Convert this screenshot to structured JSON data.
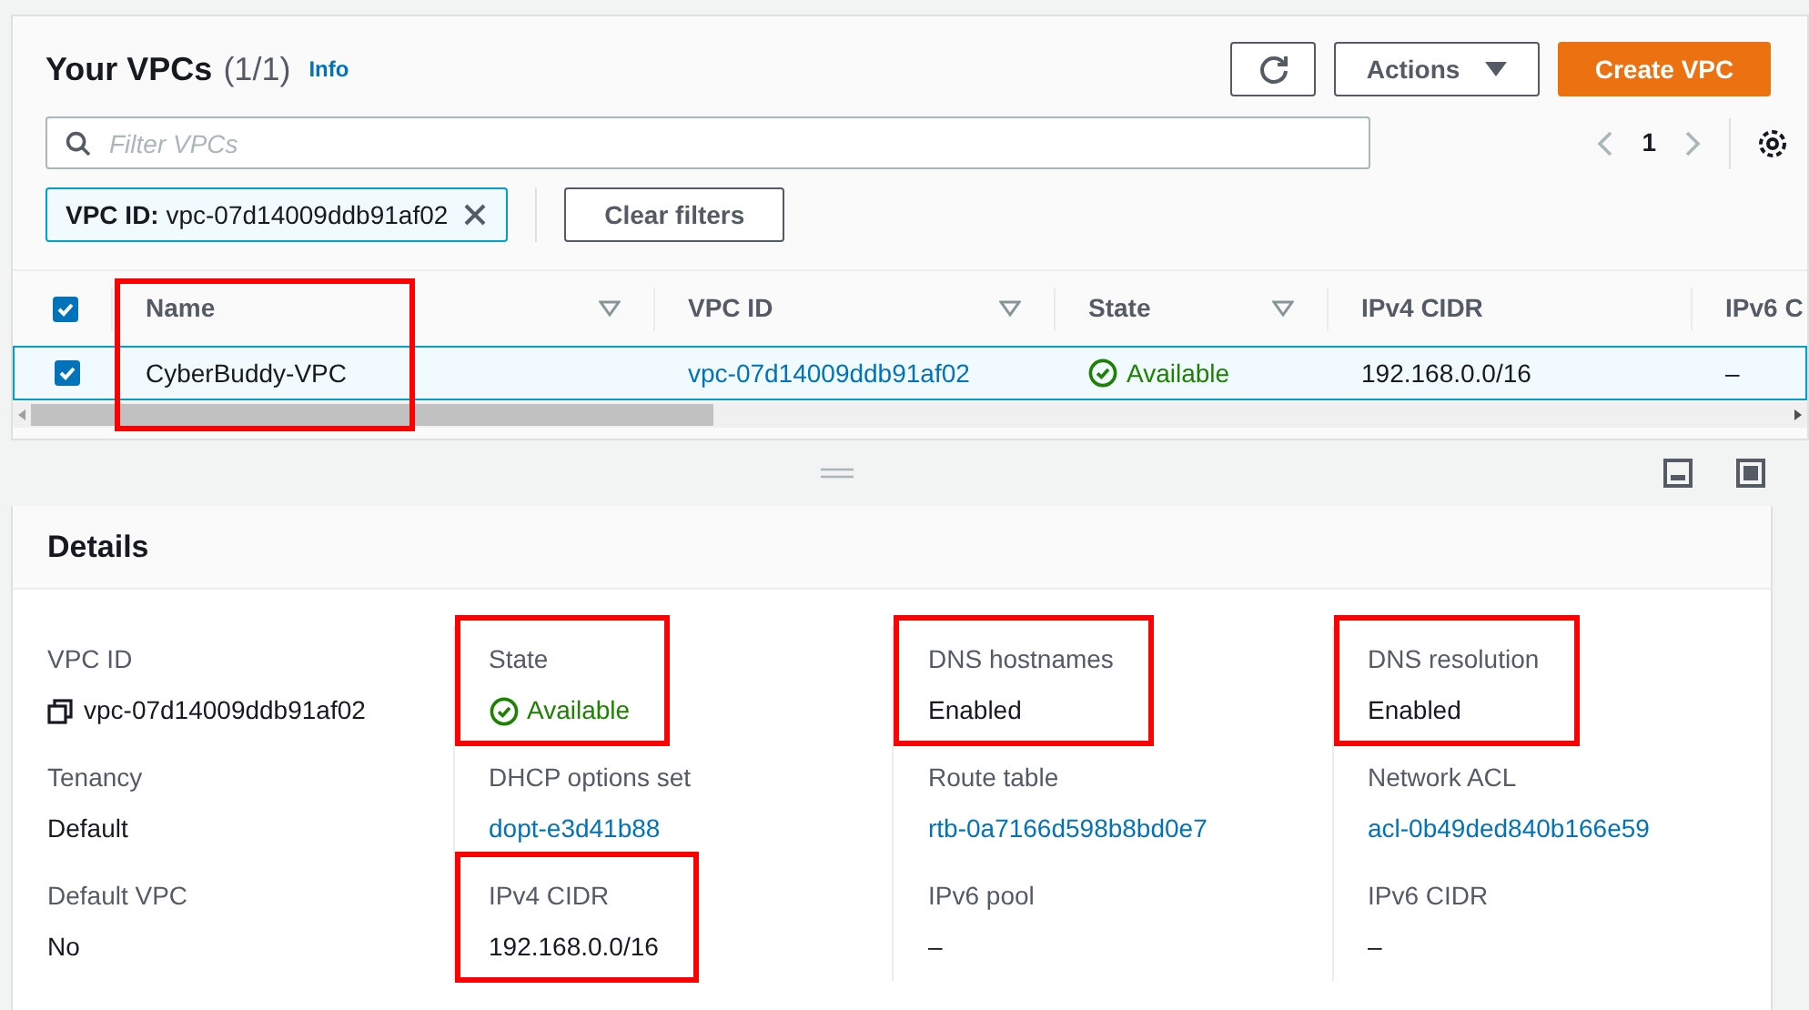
{
  "header": {
    "title": "Your VPCs",
    "count": "(1/1)",
    "info": "Info"
  },
  "toolbar": {
    "actions": "Actions",
    "create": "Create VPC"
  },
  "search": {
    "placeholder": "Filter VPCs"
  },
  "pagination": {
    "page": "1"
  },
  "filter_token": {
    "key": "VPC ID:",
    "value": "vpc-07d14009ddb91af02"
  },
  "clear_filters": "Clear filters",
  "table": {
    "all_checked": true,
    "columns": [
      {
        "label": "Name",
        "sortable": true,
        "highlighted": true
      },
      {
        "label": "VPC ID",
        "sortable": true,
        "highlighted": false
      },
      {
        "label": "State",
        "sortable": true,
        "highlighted": false
      },
      {
        "label": "IPv4 CIDR",
        "sortable": false,
        "highlighted": false
      },
      {
        "label": "IPv6 C",
        "sortable": false,
        "highlighted": false
      }
    ],
    "rows": [
      {
        "checked": true,
        "selected": true,
        "cells": [
          {
            "kind": "text",
            "text": "CyberBuddy-VPC"
          },
          {
            "kind": "link",
            "text": "vpc-07d14009ddb91af02"
          },
          {
            "kind": "status",
            "text": "Available"
          },
          {
            "kind": "text",
            "text": "192.168.0.0/16"
          },
          {
            "kind": "text",
            "text": "–"
          }
        ]
      }
    ]
  },
  "details": {
    "title": "Details",
    "fields": [
      {
        "label": "VPC ID",
        "value": "vpc-07d14009ddb91af02",
        "kind": "copy",
        "highlighted": false
      },
      {
        "label": "State",
        "value": "Available",
        "kind": "status",
        "highlighted": true
      },
      {
        "label": "DNS hostnames",
        "value": "Enabled",
        "kind": "text",
        "highlighted": true
      },
      {
        "label": "DNS resolution",
        "value": "Enabled",
        "kind": "text",
        "highlighted": true
      },
      {
        "label": "Tenancy",
        "value": "Default",
        "kind": "text",
        "highlighted": false
      },
      {
        "label": "DHCP options set",
        "value": "dopt-e3d41b88",
        "kind": "link",
        "highlighted": false
      },
      {
        "label": "Route table",
        "value": "rtb-0a7166d598b8bd0e7",
        "kind": "link",
        "highlighted": false
      },
      {
        "label": "Network ACL",
        "value": "acl-0b49ded840b166e59",
        "kind": "link",
        "highlighted": false
      },
      {
        "label": "Default VPC",
        "value": "No",
        "kind": "text",
        "highlighted": false
      },
      {
        "label": "IPv4 CIDR",
        "value": "192.168.0.0/16",
        "kind": "text",
        "highlighted": true
      },
      {
        "label": "IPv6 pool",
        "value": "–",
        "kind": "text",
        "highlighted": false
      },
      {
        "label": "IPv6 CIDR",
        "value": "–",
        "kind": "text",
        "highlighted": false
      }
    ]
  }
}
